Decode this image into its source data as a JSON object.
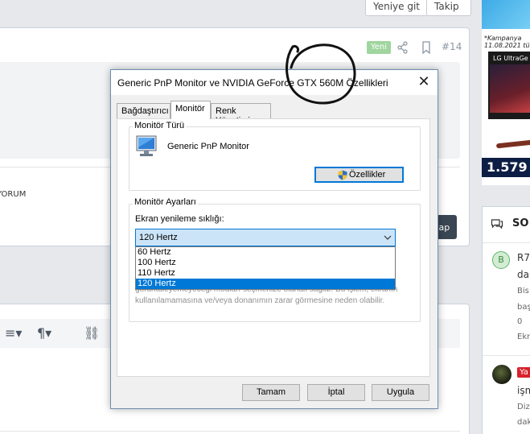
{
  "forum": {
    "top_buttons": [
      "Yeniye git",
      "Takip"
    ],
    "post": {
      "new_badge": "Yeni",
      "number": "#14",
      "snippet": "YORUM",
      "reply_label": "vap"
    },
    "side_ad": {
      "campaign_text": "*Kampanya",
      "campaign_date": "11.08.2021 tü",
      "brand": "LG UltraGe",
      "price": "1.579"
    },
    "side_panel": {
      "title": "SO",
      "items": [
        {
          "avatar": "B",
          "title": "R7",
          "line2": "da",
          "meta1": "Bis",
          "meta2": "baş",
          "meta3": "0",
          "meta4": "Ekr"
        },
        {
          "badge": "Ya",
          "title": "işm",
          "meta1": "Diz",
          "meta2": "dak"
        }
      ]
    }
  },
  "dialog": {
    "title": "Generic PnP Monitor ve NVIDIA GeForce GTX 560M Özellikleri",
    "close_glyph": "✕",
    "tabs": [
      {
        "label": "Bağdaştırıcı",
        "active": false
      },
      {
        "label": "Monitör",
        "active": true
      },
      {
        "label": "Renk Yönetimi",
        "active": false
      }
    ],
    "monitor_type": {
      "legend": "Monitör Türü",
      "name": "Generic PnP Monitor",
      "properties_button": "Özellikler"
    },
    "monitor_settings": {
      "legend": "Monitör Ayarları",
      "refresh_label": "Ekran yenileme sıklığı:",
      "selected": "120 Hertz",
      "options": [
        "60 Hertz",
        "100 Hertz",
        "110 Hertz",
        "120 Hertz"
      ],
      "selected_index": 3,
      "warning": "görüntüleyemeyeceği modları seçmenize olanak sağlar. Bu işlem, ekranın kullanılamamasına ve/veya donanımın zarar görmesine neden olabilir."
    },
    "buttons": {
      "ok": "Tamam",
      "cancel": "İptal",
      "apply": "Uygula"
    }
  },
  "colors": {
    "accent": "#0078d7",
    "selection_bg": "#cce4f7",
    "dialog_bg": "#f0f0f0",
    "new_badge": "#9fd59f",
    "red_badge": "#d8212c"
  }
}
